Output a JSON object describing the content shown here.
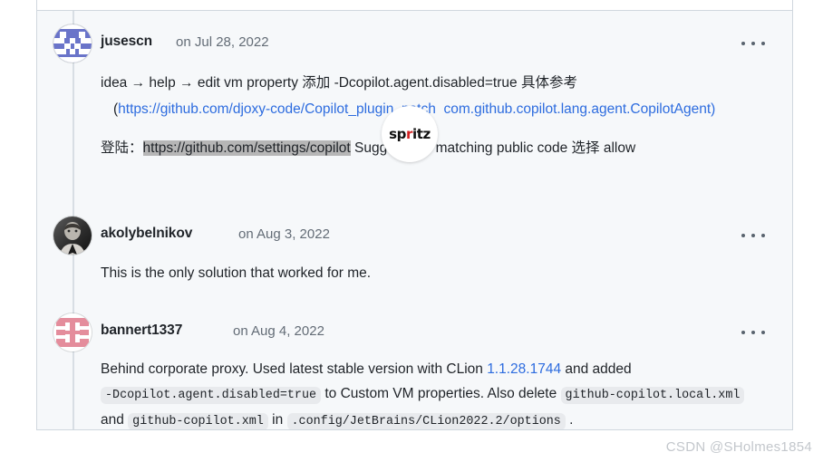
{
  "page": {
    "watermark": "CSDN @SHolmes1854"
  },
  "overlay_badge": {
    "name": "spritz-logo",
    "text_before": "sp",
    "text_accent": "r",
    "text_after": "itz",
    "accent_color": "#d32020"
  },
  "thread": {
    "comments": [
      {
        "author": "jusescn",
        "timestamp": "on Jul 28, 2022",
        "avatar": {
          "type": "identicon",
          "color": "#6a74c9",
          "alt": "jusescn avatar"
        },
        "menu_label": "•••",
        "body_line1_a": "idea → help → edit vm property  添加  -Dcopilot.agent.disabled=true  具体参考",
        "body_line1_paren_open": "(",
        "body_link1": "https://github.com/djoxy-code/Copilot_plugin_patch",
        "body_link2": "com.github.copilot.lang.agent.CopilotAgent)",
        "body_line2_label": "登陆：",
        "body_line2_selected_url": "https://github.com/settings/copilot",
        "body_line2_tail": "  Suggestions matching public code 选择 allow"
      },
      {
        "author": "akolybelnikov",
        "timestamp": "on Aug 3, 2022",
        "avatar": {
          "type": "photo",
          "color": "#3a3a3a",
          "alt": "akolybelnikov avatar"
        },
        "menu_label": "•••",
        "body_text": "This is the only solution that worked for me."
      },
      {
        "author": "bannert1337",
        "timestamp": "on Aug 4, 2022",
        "avatar": {
          "type": "identicon",
          "color": "#e48d9c",
          "alt": "bannert1337 avatar"
        },
        "menu_label": "•••",
        "body_seg1": "Behind corporate proxy. Used latest stable version with CLion ",
        "body_link_version": "1.1.28.1744",
        "body_seg2": " and added ",
        "body_code1": "-Dcopilot.agent.disabled=true",
        "body_seg3": " to Custom VM properties. Also delete ",
        "body_code2": "github-copilot.local.xml",
        "body_seg4": " and ",
        "body_code3": "github-copilot.xml",
        "body_seg5": " in ",
        "body_code4": ".config/JetBrains/CLion2022.2/options",
        "body_seg6": " ."
      }
    ]
  }
}
